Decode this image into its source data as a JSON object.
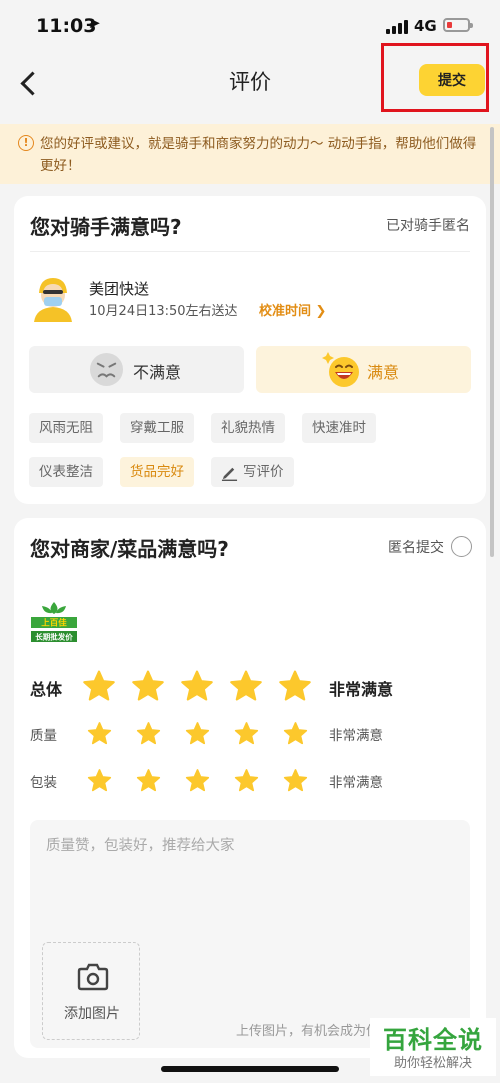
{
  "status_bar": {
    "time": "11:03",
    "location_glyph": "➤",
    "network": "4G",
    "battery_icon": "battery-low-icon"
  },
  "navbar": {
    "title": "评价",
    "submit_label": "提交"
  },
  "notice": {
    "icon": "!",
    "text": "您的好评或建议，就是骑手和商家努力的动力～ 动动手指，帮助他们做得更好！"
  },
  "rider_card": {
    "title": "您对骑手满意吗?",
    "anonymous_label": "已对骑手匿名",
    "rider_name": "美团快送",
    "delivery_time": "10月24日13:50左右送达",
    "calibrate_label": "校准时间 ❯",
    "unsatisfied_label": "不满意",
    "satisfied_label": "满意",
    "tags": [
      {
        "label": "风雨无阻",
        "active": false
      },
      {
        "label": "穿戴工服",
        "active": false
      },
      {
        "label": "礼貌热情",
        "active": false
      },
      {
        "label": "快速准时",
        "active": false
      },
      {
        "label": "仪表整洁",
        "active": false
      },
      {
        "label": "货品完好",
        "active": true
      }
    ],
    "write_review_label": "写评价"
  },
  "merchant_card": {
    "title": "您对商家/菜品满意吗?",
    "anonymous_label": "匿名提交",
    "logo_text_top": "上百佳",
    "logo_text_bottom": "长期批发价",
    "ratings": [
      {
        "label": "总体",
        "stars": 5,
        "text": "非常满意"
      },
      {
        "label": "质量",
        "stars": 5,
        "text": "非常满意"
      },
      {
        "label": "包装",
        "stars": 5,
        "text": "非常满意"
      }
    ],
    "review_placeholder": "质量赞，包装好，推荐给大家",
    "add_photo_label": "添加图片",
    "upload_hint": "上传图片，有机会成为优"
  },
  "watermark": {
    "title": "百科全说",
    "subtitle": "助你轻松解决"
  },
  "colors": {
    "accent": "#fdd333",
    "accent_text": "#e28d14",
    "star": "#fcc82c",
    "notice_bg": "#fdf1d8",
    "highlight": "#e0141e"
  }
}
